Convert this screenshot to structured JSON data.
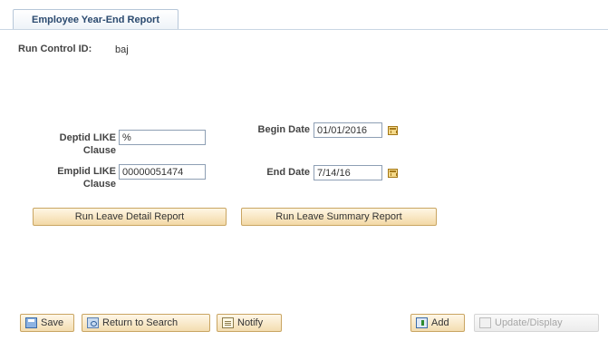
{
  "tab": {
    "label": "Employee Year-End Report"
  },
  "run_control": {
    "label": "Run Control ID:",
    "value": "baj"
  },
  "fields": {
    "deptid_label": "Deptid LIKE Clause",
    "deptid_value": "%",
    "emplid_label": "Emplid LIKE Clause",
    "emplid_value": "00000051474",
    "begin_date_label": "Begin Date",
    "begin_date_value": "01/01/2016",
    "end_date_label": "End Date",
    "end_date_value": "7/14/16"
  },
  "buttons": {
    "detail_report": "Run Leave Detail Report",
    "summary_report": "Run Leave Summary Report"
  },
  "toolbar": {
    "save": "Save",
    "return_to_search": "Return to Search",
    "notify": "Notify",
    "add": "Add",
    "update_display": "Update/Display"
  },
  "icons": {
    "begin_date_calendar": "calendar-icon",
    "end_date_calendar": "calendar-icon",
    "save": "save-icon",
    "return_to_search": "return-to-search-icon",
    "notify": "notify-icon",
    "add": "add-icon",
    "update_display": "update-display-icon"
  },
  "colors": {
    "button_fill": "#f3d9a6",
    "button_border": "#c9a562",
    "tab_text": "#2b4a6f",
    "disabled_text": "#a6a6a6"
  }
}
